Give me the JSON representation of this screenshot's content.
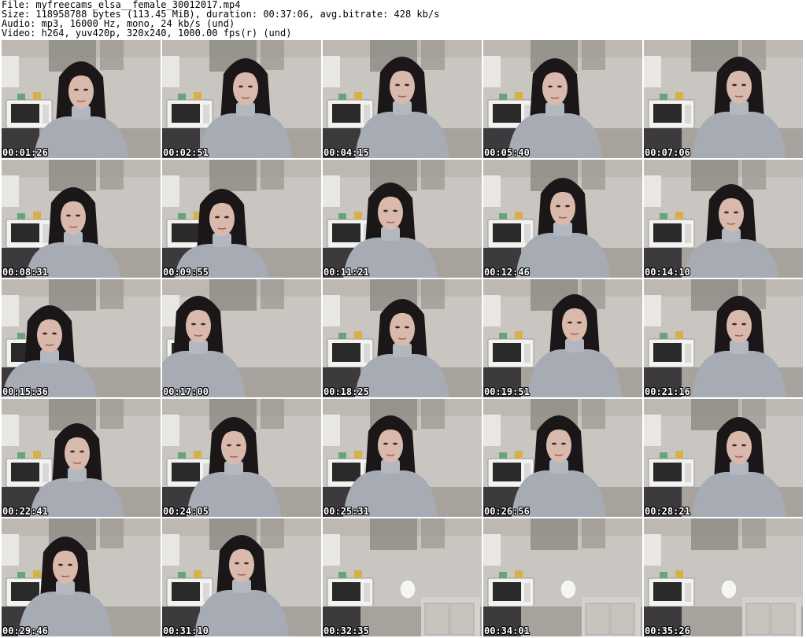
{
  "header": {
    "file_line": "File: myfreecams_elsa__female_30012017.mp4",
    "size_line": "Size: 118958788 bytes (113.45 MiB), duration: 00:37:06, avg.bitrate: 428 kb/s",
    "audio_line": "Audio: mp3, 16000 Hz, mono, 24 kb/s (und)",
    "video_line": "Video: h264, yuv420p, 320x240, 1000.00 fps(r) (und)"
  },
  "thumbnails": [
    {
      "timestamp": "00:01:26",
      "person": "woman-in-grey-turtleneck"
    },
    {
      "timestamp": "00:02:51",
      "person": "woman-in-grey-turtleneck"
    },
    {
      "timestamp": "00:04:15",
      "person": "woman-in-grey-turtleneck"
    },
    {
      "timestamp": "00:05:40",
      "person": "woman-in-grey-turtleneck"
    },
    {
      "timestamp": "00:07:06",
      "person": "woman-in-grey-turtleneck"
    },
    {
      "timestamp": "00:08:31",
      "person": "woman-in-grey-turtleneck"
    },
    {
      "timestamp": "00:09:55",
      "person": "woman-in-grey-turtleneck"
    },
    {
      "timestamp": "00:11:21",
      "person": "woman-in-grey-turtleneck"
    },
    {
      "timestamp": "00:12:46",
      "person": "woman-in-grey-turtleneck"
    },
    {
      "timestamp": "00:14:10",
      "person": "woman-in-grey-turtleneck"
    },
    {
      "timestamp": "00:15:36",
      "person": "woman-in-grey-turtleneck"
    },
    {
      "timestamp": "00:17:00",
      "person": "woman-in-grey-turtleneck"
    },
    {
      "timestamp": "00:18:25",
      "person": "woman-in-grey-turtleneck"
    },
    {
      "timestamp": "00:19:51",
      "person": "woman-in-grey-turtleneck"
    },
    {
      "timestamp": "00:21:16",
      "person": "woman-in-grey-turtleneck"
    },
    {
      "timestamp": "00:22:41",
      "person": "woman-in-grey-turtleneck"
    },
    {
      "timestamp": "00:24:05",
      "person": "woman-in-grey-turtleneck"
    },
    {
      "timestamp": "00:25:31",
      "person": "woman-in-grey-turtleneck"
    },
    {
      "timestamp": "00:26:56",
      "person": "woman-in-grey-turtleneck"
    },
    {
      "timestamp": "00:28:21",
      "person": "woman-in-grey-turtleneck"
    },
    {
      "timestamp": "00:29:46",
      "person": "woman-in-grey-turtleneck"
    },
    {
      "timestamp": "00:31:10",
      "person": "woman-in-grey-turtleneck"
    },
    {
      "timestamp": "00:32:35",
      "person": "none"
    },
    {
      "timestamp": "00:34:01",
      "person": "none"
    },
    {
      "timestamp": "00:35:26",
      "person": "none"
    }
  ],
  "colors": {
    "wall": "#c9c5c0",
    "cabinet": "#8a857f",
    "microwave": "#f2f2f0",
    "hair": "#1b1719",
    "sweater": "#a6abb4",
    "skin": "#d8b9ac"
  }
}
